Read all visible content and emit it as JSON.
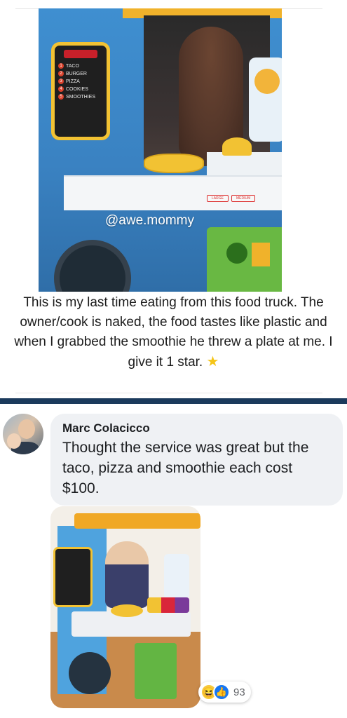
{
  "post": {
    "image": {
      "watermark": "@awe.mommy",
      "menu_board": {
        "items": [
          {
            "num": "1",
            "label": "TACO"
          },
          {
            "num": "2",
            "label": "BURGER"
          },
          {
            "num": "3",
            "label": "PIZZA"
          },
          {
            "num": "4",
            "label": "COOKIES"
          },
          {
            "num": "5",
            "label": "SMOOTHIES"
          }
        ]
      },
      "size_tags": [
        "LARGE",
        "MEDIUM"
      ]
    },
    "caption": "This is my last time eating from this food truck. The owner/cook is naked, the food tastes like plastic and when I grabbed the smoothie he threw a plate at me. I give it 1 star.",
    "caption_icon": "star-icon"
  },
  "comment": {
    "author": "Marc Colacicco",
    "text": "Thought the service was great but the taco, pizza and smoothie each cost $100.",
    "reactions": {
      "icons": [
        "haha-icon",
        "like-icon"
      ],
      "count": "93"
    }
  },
  "colors": {
    "divider": "#1b3a5c",
    "bubble": "#eff1f4",
    "like": "#1877f2",
    "haha": "#f7c93a",
    "star": "#f5c518"
  }
}
